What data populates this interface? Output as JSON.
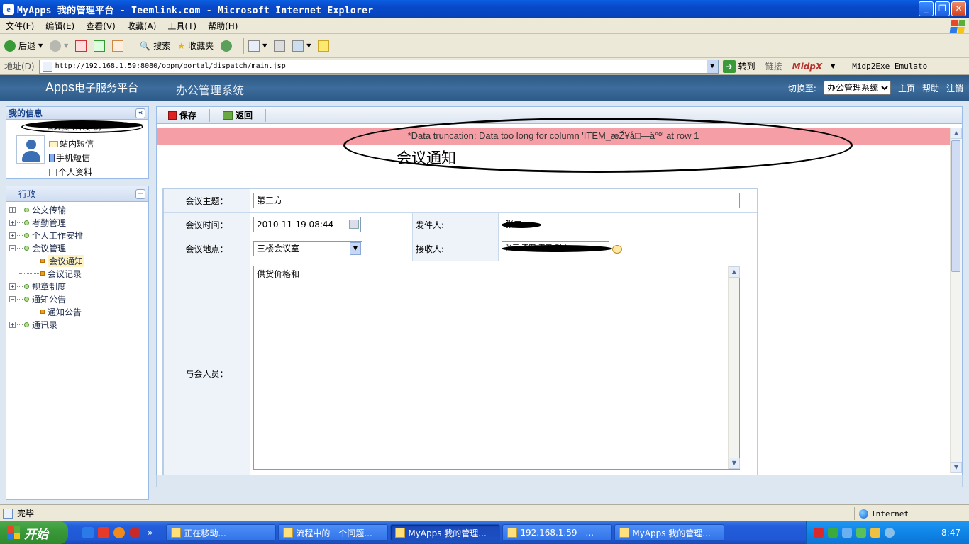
{
  "window": {
    "title": "MyApps 我的管理平台 - Teemlink.com - Microsoft Internet Explorer",
    "minimize": "_",
    "maximize": "❐",
    "close": "✕"
  },
  "menu": [
    "文件(F)",
    "编辑(E)",
    "查看(V)",
    "收藏(A)",
    "工具(T)",
    "帮助(H)"
  ],
  "toolbar": {
    "back": "后退",
    "search": "搜索",
    "favorites": "收藏夹"
  },
  "address": {
    "label": "地址(D)",
    "url": "http://192.168.1.59:8080/obpm/portal/dispatch/main.jsp",
    "go": "转到",
    "links": "链接",
    "midpx": "MidpX",
    "midp2exe": "Midp2Exe Emulato"
  },
  "app": {
    "logo_main": "Apps",
    "logo_sub": "电子服务平台",
    "system": "办公管理系统",
    "switch_label": "切换至:",
    "switch_value": "办公管理系统",
    "links": [
      "主页",
      "帮助",
      "注销"
    ]
  },
  "info": {
    "title": "我的信息",
    "user_name": "管理员 (开发部)",
    "links": [
      "站内短信",
      "手机短信",
      "个人资料"
    ]
  },
  "tree": {
    "title": "行政",
    "nodes": [
      {
        "label": "公文传输",
        "level": 0,
        "expanded": false
      },
      {
        "label": "考勤管理",
        "level": 0,
        "expanded": false
      },
      {
        "label": "个人工作安排",
        "level": 0,
        "expanded": false
      },
      {
        "label": "会议管理",
        "level": 0,
        "expanded": true
      },
      {
        "label": "会议通知",
        "level": 1,
        "active": true
      },
      {
        "label": "会议记录",
        "level": 1
      },
      {
        "label": "规章制度",
        "level": 0,
        "expanded": false
      },
      {
        "label": "通知公告",
        "level": 0,
        "expanded": true
      },
      {
        "label": "通知公告",
        "level": 1
      },
      {
        "label": "通讯录",
        "level": 0,
        "expanded": false
      }
    ]
  },
  "form_toolbar": {
    "save": "保存",
    "back": "返回"
  },
  "error": "*Data truncation: Data too long for column 'ITEM_æŽ¥å□—ä°º' at row 1",
  "form": {
    "title": "会议通知",
    "subject_label": "会议主题：",
    "subject_value": "第三方",
    "time_label": "会议时间：",
    "time_value": "2010-11-19 08:44",
    "sender_label": "发件人:",
    "sender_value": "张三",
    "place_label": "会议地点：",
    "place_value": "三楼会议室",
    "receiver_label": "接收人:",
    "receiver_value": "张三;李四;王五;赵六",
    "attendees_label": "与会人员：",
    "attendees_value": "供货价格和"
  },
  "status": {
    "text": "完毕",
    "zone": "Internet"
  },
  "taskbar": {
    "start": "开始",
    "tasks": [
      {
        "label": "正在移动...",
        "active": false
      },
      {
        "label": "流程中的一个问题...",
        "active": false
      },
      {
        "label": "MyApps 我的管理...",
        "active": true
      },
      {
        "label": "192.168.1.59 - ...",
        "active": false
      },
      {
        "label": "MyApps 我的管理...",
        "active": false
      }
    ],
    "clock": "8:47"
  }
}
